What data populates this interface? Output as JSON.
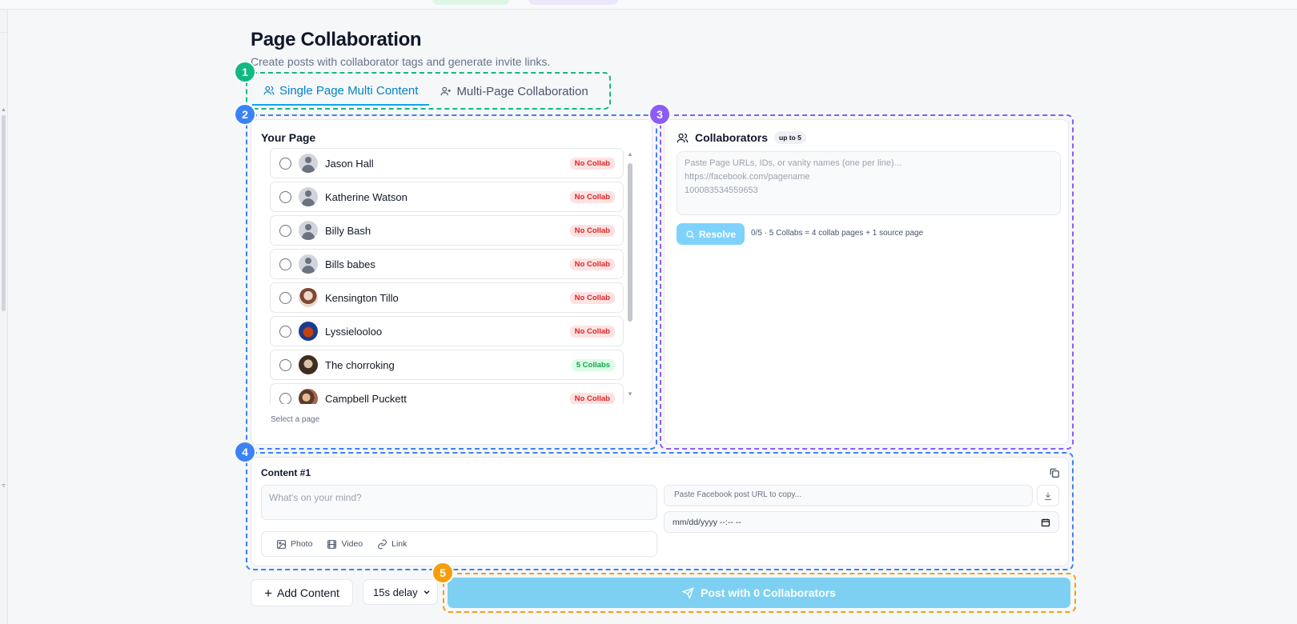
{
  "header": {
    "title": "Page Collaboration",
    "subtitle": "Create posts with collaborator tags and generate invite links."
  },
  "steps": [
    "1",
    "2",
    "3",
    "4",
    "5"
  ],
  "tabs": [
    {
      "label": "Single Page Multi Content",
      "icon": "users-icon",
      "active": true
    },
    {
      "label": "Multi-Page Collaboration",
      "icon": "user-plus-icon",
      "active": false
    }
  ],
  "your_page": {
    "title": "Your Page",
    "hint": "Select a page",
    "pages": [
      {
        "name": "Jason Hall",
        "status": "No Collab",
        "avatar": "generic"
      },
      {
        "name": "Katherine Watson",
        "status": "No Collab",
        "avatar": "generic"
      },
      {
        "name": "Billy Bash",
        "status": "No Collab",
        "avatar": "generic"
      },
      {
        "name": "Bills babes",
        "status": "No Collab",
        "avatar": "generic"
      },
      {
        "name": "Kensington Tillo",
        "status": "No Collab",
        "avatar": "photo-woman"
      },
      {
        "name": "Lyssielooloo",
        "status": "No Collab",
        "avatar": "photo-cartoon"
      },
      {
        "name": "The chorroking",
        "status": "5 Collabs",
        "avatar": "photo-dark"
      },
      {
        "name": "Campbell Puckett",
        "status": "No Collab",
        "avatar": "photo-couple"
      }
    ]
  },
  "collaborators": {
    "title": "Collaborators",
    "limit_chip": "up to 5",
    "placeholder": "Paste Page URLs, IDs, or vanity names (one per line)...\nhttps://facebook.com/pagename\n100083534559653",
    "resolve_label": "Resolve",
    "note": "0/5 · 5 Collabs = 4 collab pages + 1 source page"
  },
  "content": {
    "label": "Content #1",
    "text_placeholder": "What's on your mind?",
    "media": [
      {
        "label": "Photo",
        "icon": "photo-icon"
      },
      {
        "label": "Video",
        "icon": "film-icon"
      },
      {
        "label": "Link",
        "icon": "link-icon"
      }
    ],
    "url_placeholder": "Paste Facebook post URL to copy...",
    "datetime_placeholder": "mm/dd/yyyy --:-- --"
  },
  "footer": {
    "add_content_label": "Add Content",
    "delay_value": "15s delay",
    "post_label": "Post with 0 Collaborators"
  },
  "colors": {
    "step1": "#10b981",
    "step2": "#3b82f6",
    "step3": "#8b5cf6",
    "step4": "#3b82f6",
    "step5": "#f59e0b",
    "accent": "#0ea5e9",
    "button_disabled": "#7dd0f1"
  }
}
